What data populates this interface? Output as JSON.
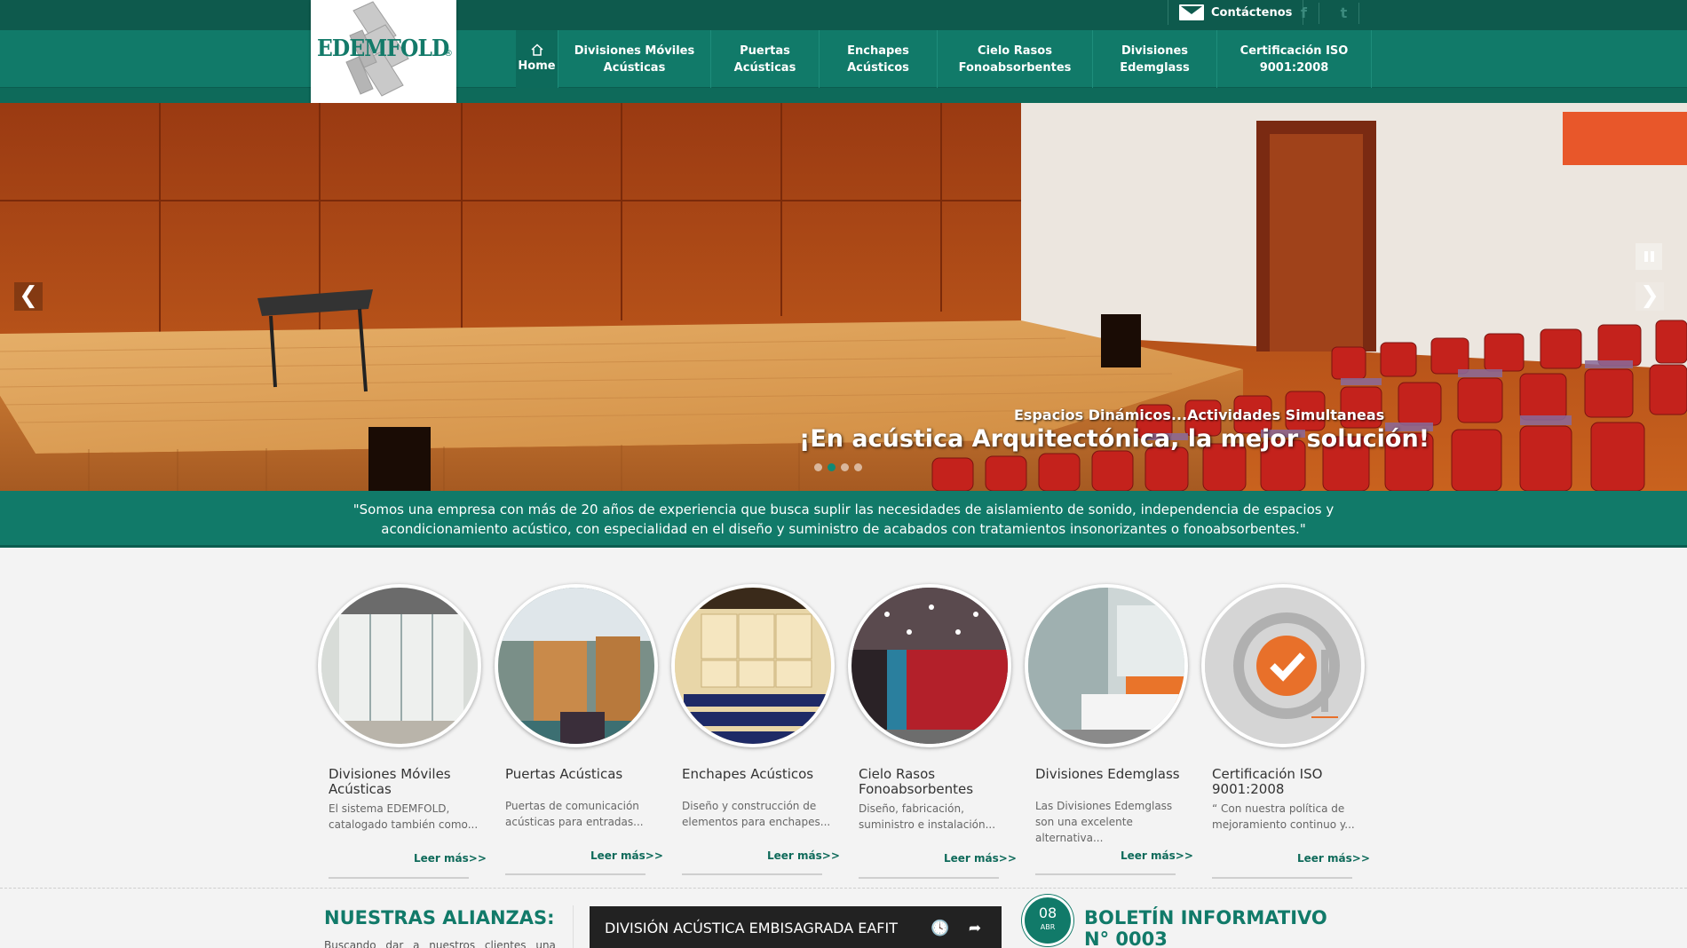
{
  "topbar": {
    "contact_label": "Contáctenos",
    "social": [
      {
        "icon": "facebook-icon",
        "glyph": "f"
      },
      {
        "icon": "twitter-icon",
        "glyph": "t"
      }
    ]
  },
  "logo": {
    "text": "EDEMFOLD",
    "registered": "®"
  },
  "nav": {
    "home": "Home",
    "items": [
      "Divisiones Móviles Acústicas",
      "Puertas Acústicas",
      "Enchapes Acústicos",
      "Cielo Rasos Fonoabsorbentes",
      "Divisiones Edemglass",
      "Certificación ISO 9001:2008"
    ]
  },
  "hero": {
    "subtitle": "Espacios Dinámicos...Actividades Simultaneas",
    "title": "¡En acústica Arquitectónica, la mejor solución!",
    "prev_glyph": "❮",
    "next_glyph": "❯"
  },
  "quote": "\"Somos una empresa con más de 20 años de experiencia que busca suplir las necesidades de aislamiento de sonido, independencia de espacios y acondicionamiento acústico, con especialidad en el diseño y suministro de acabados con tratamientos insonorizantes o fonoabsorbentes.\"",
  "services": [
    {
      "title": "Divisiones Móviles Acústicas",
      "desc": "El sistema EDEMFOLD, catalogado también como...",
      "more": "Leer más>>"
    },
    {
      "title": "Puertas Acústicas",
      "desc": "Puertas de comunicación acústicas para entradas...",
      "more": "Leer más>>"
    },
    {
      "title": "Enchapes Acústicos",
      "desc": "Diseño y construcción de elementos para enchapes...",
      "more": "Leer más>>"
    },
    {
      "title": "Cielo Rasos Fonoabsorbentes",
      "desc": "Diseño, fabricación, suministro e instalación...",
      "more": "Leer más>>"
    },
    {
      "title": "Divisiones Edemglass",
      "desc": "Las Divisiones Edemglass son una excelente alternativa...",
      "more": "Leer más>>"
    },
    {
      "title": "Certificación ISO 9001:2008",
      "desc": "“ Con nuestra política de mejoramiento continuo y...",
      "more": "Leer más>>"
    }
  ],
  "alianzas": {
    "title": "NUESTRAS ALIANZAS:",
    "text": "Buscando dar a nuestros clientes una"
  },
  "video": {
    "title": "DIVISIÓN ACÚSTICA EMBISAGRADA EAFIT",
    "clock_glyph": "🕓",
    "share_glyph": "➦"
  },
  "boletin": {
    "day": "08",
    "month": "ABR",
    "title": "BOLETÍN INFORMATIVO N° 0003"
  },
  "colors": {
    "primary": "#117a69",
    "dark": "#0e5a4d",
    "accent_orange": "#e8702a"
  }
}
